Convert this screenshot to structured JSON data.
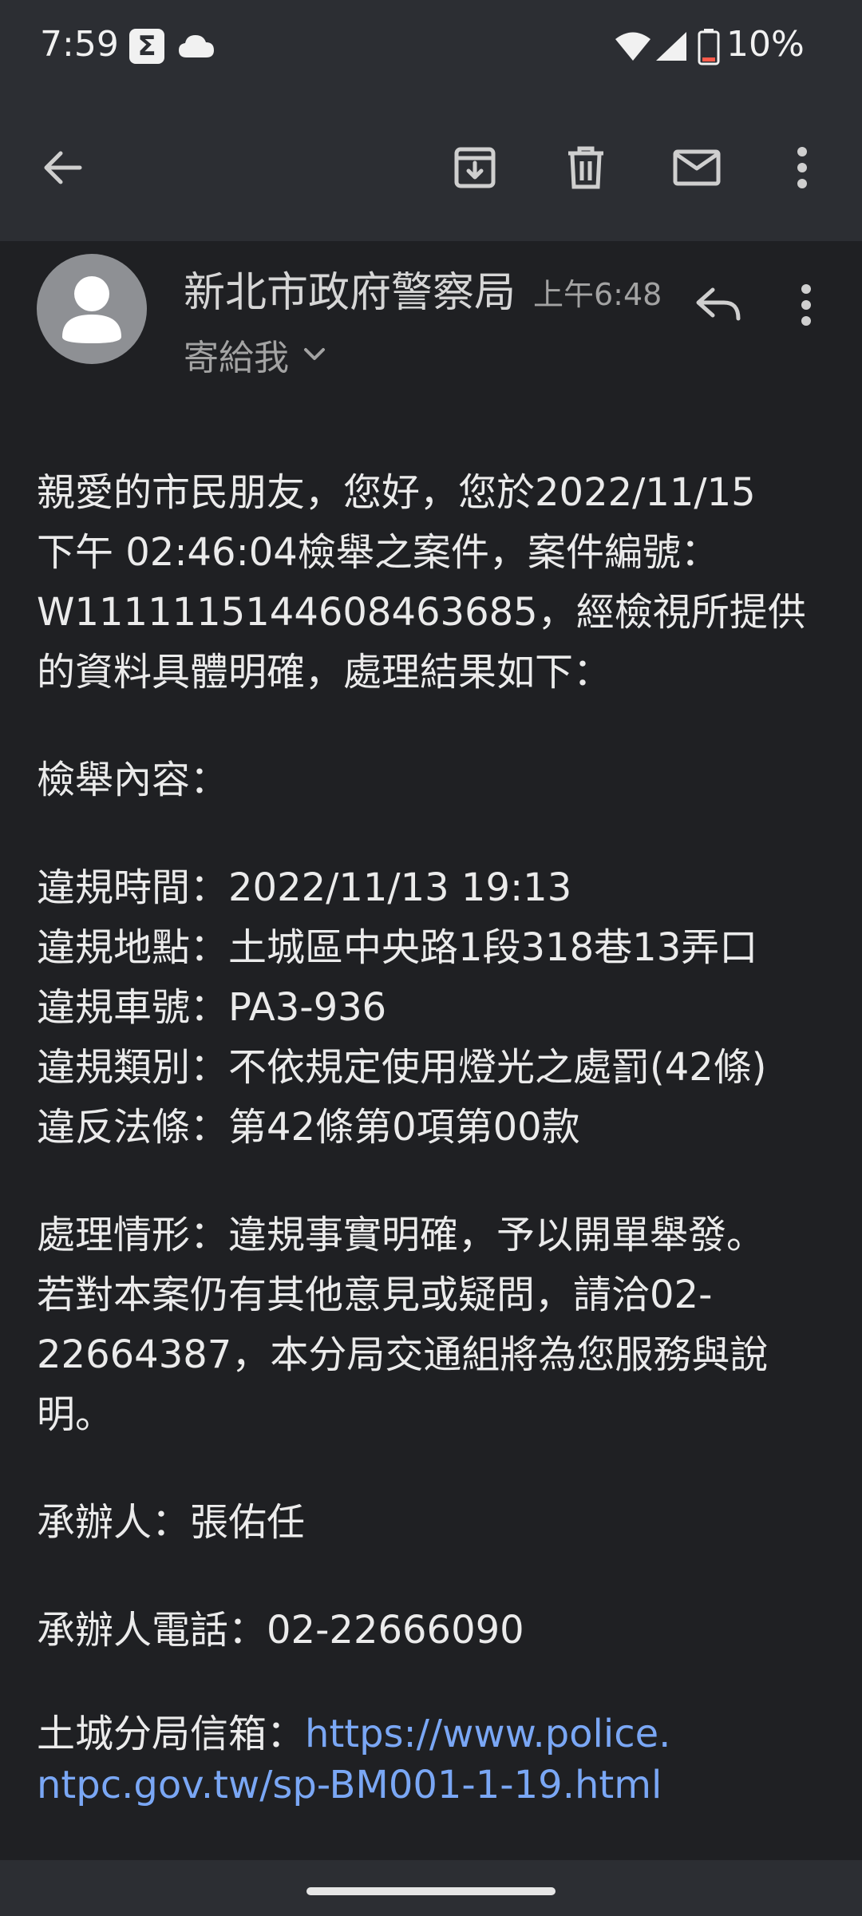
{
  "status_bar": {
    "time": "7:59",
    "app_badge": "Σ",
    "battery": "10%"
  },
  "icons": {
    "back": "arrow-left-icon",
    "archive": "archive-icon",
    "delete": "trash-icon",
    "mark_unread": "mail-icon",
    "more": "more-vert-icon",
    "reply": "reply-icon"
  },
  "email": {
    "sender": "新北市政府警察局",
    "time": "上午6:48",
    "recipient": "寄給我",
    "paragraph1": [
      "親愛的市民朋友，您好，您於2022/11/15",
      "下午 02:46:04檢舉之案件，案件編號：",
      "W1111115144608463685，經檢視所提供",
      "的資料具體明確，處理結果如下："
    ],
    "section_title": "檢舉內容：",
    "details": [
      "違規時間：2022/11/13 19:13",
      "違規地點：土城區中央路1段318巷13弄口",
      "違規車號：PA3-936",
      "違規類別：不依規定使用燈光之處罰(42條)",
      "違反法條：第42條第0項第00款"
    ],
    "paragraph2": [
      "處理情形：違規事實明確，予以開單舉發。",
      "若對本案仍有其他意見或疑問，請洽02-",
      "22664387，本分局交通組將為您服務與說",
      "明。"
    ],
    "handler": "承辦人：張佑任",
    "handler_phone": "承辦人電話：02-22666090",
    "mailbox_label": "土城分局信箱：",
    "mailbox_link_line1": "https://www.police.",
    "mailbox_link_line2": "ntpc.gov.tw/sp-BM001-1-19.html"
  }
}
